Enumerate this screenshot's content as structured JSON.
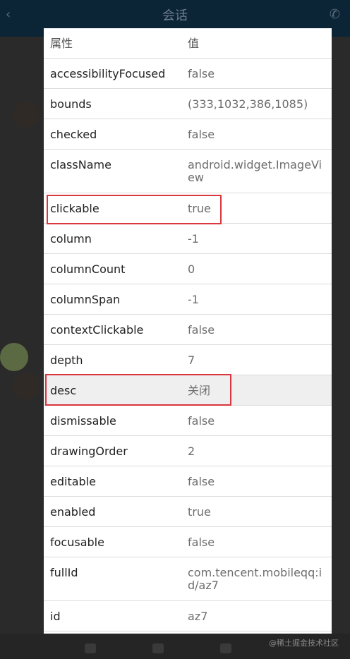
{
  "background": {
    "title": "会话",
    "watermark": "@稀土掘金技术社区"
  },
  "table": {
    "header": {
      "key": "属性",
      "value": "值"
    },
    "rows": [
      {
        "key": "accessibilityFocused",
        "value": "false"
      },
      {
        "key": "bounds",
        "value": "(333,1032,386,1085)"
      },
      {
        "key": "checked",
        "value": "false"
      },
      {
        "key": "className",
        "value": "android.widget.ImageView"
      },
      {
        "key": "clickable",
        "value": "true"
      },
      {
        "key": "column",
        "value": "-1"
      },
      {
        "key": "columnCount",
        "value": "0"
      },
      {
        "key": "columnSpan",
        "value": "-1"
      },
      {
        "key": "contextClickable",
        "value": "false"
      },
      {
        "key": "depth",
        "value": "7"
      },
      {
        "key": "desc",
        "value": "关闭"
      },
      {
        "key": "dismissable",
        "value": "false"
      },
      {
        "key": "drawingOrder",
        "value": "2"
      },
      {
        "key": "editable",
        "value": "false"
      },
      {
        "key": "enabled",
        "value": "true"
      },
      {
        "key": "focusable",
        "value": "false"
      },
      {
        "key": "fullId",
        "value": "com.tencent.mobileqq:id/az7"
      },
      {
        "key": "id",
        "value": "az7"
      }
    ]
  },
  "colors": {
    "highlight": "#d9363e"
  }
}
